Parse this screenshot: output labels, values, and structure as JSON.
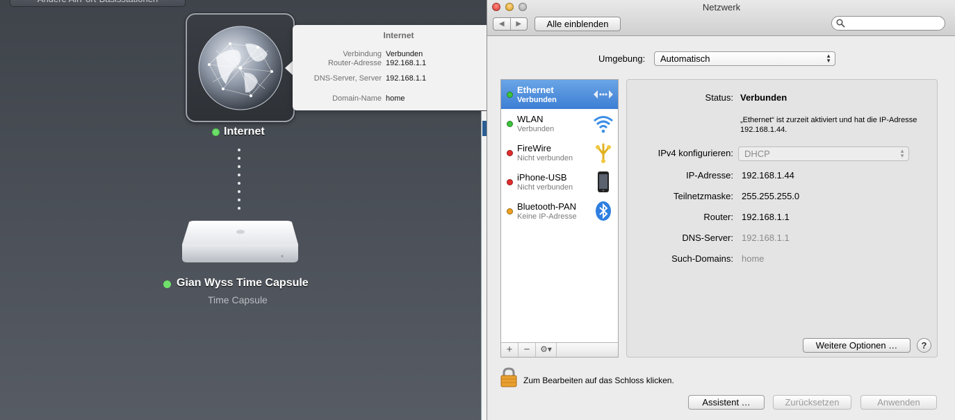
{
  "airport": {
    "other_stations_button": "Andere AirPort-Basisstationen",
    "internet_label": "Internet",
    "device_name": "Gian Wyss Time Capsule",
    "device_model": "Time Capsule",
    "status_color": "#6fe06a",
    "popover": {
      "title": "Internet",
      "rows": [
        {
          "key": "Verbindung",
          "value": "Verbunden"
        },
        {
          "key": "Router-Adresse",
          "value": "192.168.1.1"
        },
        {
          "key": "DNS-Server, Server",
          "value": "192.168.1.1"
        },
        {
          "key": "Domain-Name",
          "value": "home"
        }
      ]
    }
  },
  "network": {
    "window_title": "Netzwerk",
    "show_all_button": "Alle einblenden",
    "search_placeholder": "",
    "location_label": "Umgebung:",
    "location_value": "Automatisch",
    "services": [
      {
        "name": "Ethernet",
        "status": "Verbunden",
        "dot": "#3cc43c",
        "icon": "ethernet-icon",
        "selected": true
      },
      {
        "name": "WLAN",
        "status": "Verbunden",
        "dot": "#3cc43c",
        "icon": "wifi-icon",
        "selected": false
      },
      {
        "name": "FireWire",
        "status": "Nicht verbunden",
        "dot": "#e02d2d",
        "icon": "firewire-icon",
        "selected": false
      },
      {
        "name": "iPhone-USB",
        "status": "Nicht verbunden",
        "dot": "#e02d2d",
        "icon": "iphone-icon",
        "selected": false
      },
      {
        "name": "Bluetooth-PAN",
        "status": "Keine IP-Adresse",
        "dot": "#f0a020",
        "icon": "bluetooth-icon",
        "selected": false
      }
    ],
    "toolbar": {
      "add": "+",
      "remove": "−",
      "gear": "⚙▾"
    },
    "detail": {
      "status_label": "Status:",
      "status_value": "Verbunden",
      "status_note": "„Ethernet“ ist zurzeit aktiviert und hat die IP-Adresse 192.168.1.44.",
      "ipv4_label": "IPv4 konfigurieren:",
      "ipv4_value": "DHCP",
      "ip_label": "IP-Adresse:",
      "ip_value": "192.168.1.44",
      "subnet_label": "Teilnetzmaske:",
      "subnet_value": "255.255.255.0",
      "router_label": "Router:",
      "router_value": "192.168.1.1",
      "dns_label": "DNS-Server:",
      "dns_value": "192.168.1.1",
      "search_domains_label": "Such-Domains:",
      "search_domains_value": "home",
      "advanced_button": "Weitere Optionen …",
      "help_button": "?"
    },
    "lock_text": "Zum Bearbeiten auf das Schloss klicken.",
    "buttons": {
      "assistant": "Assistent …",
      "revert": "Zurücksetzen",
      "apply": "Anwenden"
    }
  }
}
